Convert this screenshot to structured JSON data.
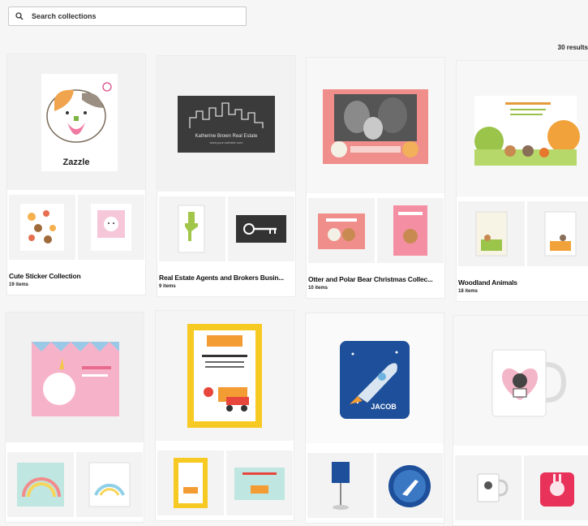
{
  "search": {
    "placeholder": "Search collections"
  },
  "results": {
    "label": "30 results"
  },
  "collections": [
    {
      "title": "Cute Sticker Collection",
      "count": "19 items"
    },
    {
      "title": "Real Estate Agents and Brokers Busin...",
      "count": "9 items"
    },
    {
      "title": "Otter and Polar Bear Christmas Collec...",
      "count": "10 items"
    },
    {
      "title": "Woodland Animals",
      "count": "18 items"
    }
  ],
  "products": {
    "sticker_brand": "Zazzle",
    "card_name": "Katherine Brown Real Estate",
    "card_site": "www.your-website.com",
    "pillow_name": "JACOB"
  },
  "colors": {
    "background": "#f6f6f6",
    "card": "#ffffff",
    "border": "#ececec",
    "pink": "#f1a9bd",
    "coral": "#ef8e8a",
    "navy": "#1e4f9a",
    "construction_yellow": "#f7c923"
  }
}
